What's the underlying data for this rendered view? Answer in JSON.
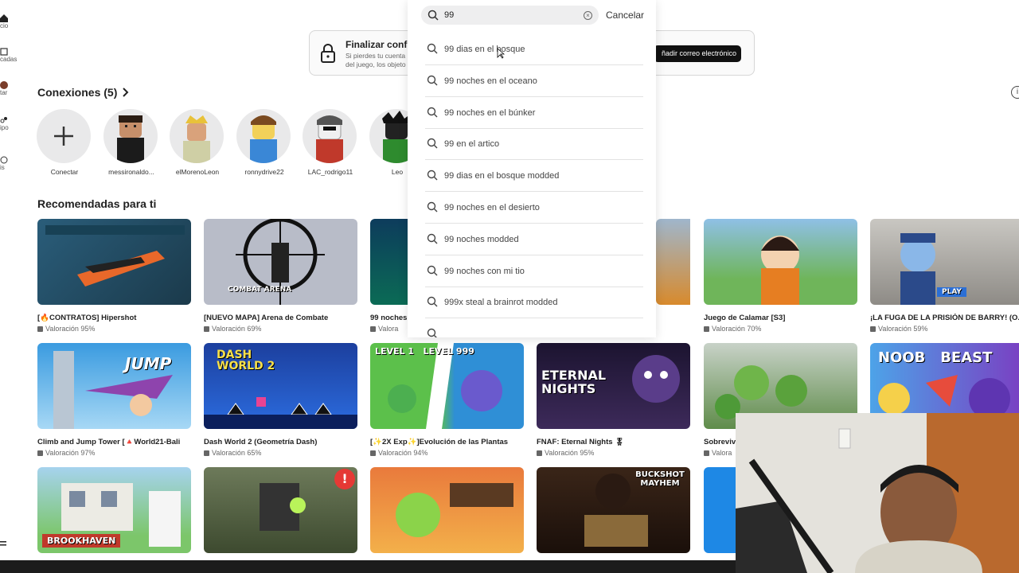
{
  "rail": {
    "items": [
      {
        "label": "cio",
        "icon": "home-icon"
      },
      {
        "label": "cadas",
        "icon": "charts-icon"
      },
      {
        "label": "tar",
        "icon": "avatar-icon"
      },
      {
        "label": "ipo",
        "icon": "groups-icon"
      },
      {
        "label": "is",
        "icon": "more-icon"
      }
    ]
  },
  "banner": {
    "title": "Finalizar config",
    "desc_line1": "Si pierdes tu cuenta",
    "desc_line2": "del juego, los objeto",
    "button_label": "ñadir correo electrónico"
  },
  "connections": {
    "title": "Conexiones (5)",
    "friends": [
      {
        "name": "Conectar"
      },
      {
        "name": "messironaldo..."
      },
      {
        "name": "elMorenoLeon"
      },
      {
        "name": "ronnydrive22"
      },
      {
        "name": "LAC_rodrigo11"
      },
      {
        "name": "Leo"
      }
    ]
  },
  "recommended": {
    "title": "Recomendadas para ti",
    "row1": [
      {
        "name": "[🔥CONTRATOS] Hipershot",
        "rating": "Valoración 95%",
        "thumb_text": ""
      },
      {
        "name": "[NUEVO MAPA] Arena de Combate",
        "rating": "Valoración 69%",
        "thumb_text": "COMBAT ARENA"
      },
      {
        "name": "99 noches",
        "rating": "Valora",
        "thumb_text": ""
      },
      {
        "name": "",
        "rating": "",
        "thumb_text": ""
      },
      {
        "name": "Juego de Calamar [S3]",
        "rating": "Valoración 70%",
        "thumb_text": ""
      },
      {
        "name": "¡LA FUGA DE LA PRISIÓN DE BARRY! (O...",
        "rating": "Valoración 59%",
        "thumb_text": "PLAY"
      }
    ],
    "row2": [
      {
        "name": "Climb and Jump Tower [🔺World21-Bali",
        "rating": "Valoración 97%",
        "thumb_text": "JUMP"
      },
      {
        "name": "Dash World 2 (Geometría Dash)",
        "rating": "Valoración 65%",
        "thumb_text": "DASH WORLD 2"
      },
      {
        "name": "[✨2X Exp✨]Evolución de las Plantas",
        "rating": "Valoración 94%",
        "thumb_text": "LEVEL 1   LEVEL 999"
      },
      {
        "name": "FNAF: Eternal Nights 🎖",
        "rating": "Valoración 95%",
        "thumb_text": "ETERNAL NIGHTS"
      },
      {
        "name": "Sobreviv",
        "rating": "Valora",
        "thumb_text": ""
      },
      {
        "name": "",
        "rating": "",
        "thumb_text": "NOOB   BEAST"
      }
    ],
    "row3": [
      {
        "thumb_text": "BROOKHAVEN"
      },
      {
        "thumb_text": "!"
      },
      {
        "thumb_text": ""
      },
      {
        "thumb_text": "BUCKSHOT MAYHEM"
      },
      {
        "thumb_text": ""
      }
    ]
  },
  "search": {
    "value": "99",
    "cancel_label": "Cancelar",
    "suggestions": [
      "99 dias en el bosque",
      "99 noches en el oceano",
      "99 noches en el búnker",
      "99 en el artico",
      "99 dias en el bosque modded",
      "99 noches en el desierto",
      "99 noches modded",
      "99 noches con mi tio",
      "999x steal a brainrot modded"
    ]
  },
  "colors": {
    "background": "#ffffff",
    "panel_shadow": "#e2e2e2",
    "button_dark": "#111111",
    "avatar_bg": "#e9e9ea"
  }
}
